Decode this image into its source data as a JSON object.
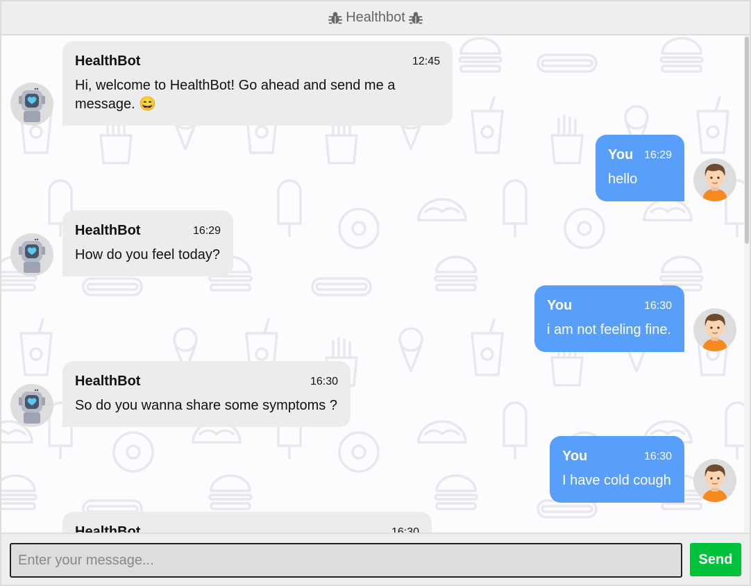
{
  "header": {
    "title": "Healthbot",
    "left_icon": "bug-icon",
    "right_icon": "bug-icon"
  },
  "messages": [
    {
      "sender": "HealthBot",
      "time": "12:45",
      "text": "Hi, welcome to HealthBot! Go ahead and send me a message. 😄"
    },
    {
      "sender": "You",
      "time": "16:29",
      "text": "hello"
    },
    {
      "sender": "HealthBot",
      "time": "16:29",
      "text": "How do you feel today?"
    },
    {
      "sender": "You",
      "time": "16:30",
      "text": "i am not feeling fine."
    },
    {
      "sender": "HealthBot",
      "time": "16:30",
      "text": "So do you wanna share some symptoms ?"
    },
    {
      "sender": "You",
      "time": "16:30",
      "text": "I have cold cough"
    },
    {
      "sender": "HealthBot",
      "time": "16:30",
      "text": ""
    }
  ],
  "composer": {
    "placeholder": "Enter your message...",
    "value": "",
    "send_label": "Send"
  },
  "colors": {
    "user_bubble": "#579ffb",
    "bot_bubble": "#ececec",
    "send_button": "#00c23a",
    "header_bg": "#eeeeee"
  }
}
